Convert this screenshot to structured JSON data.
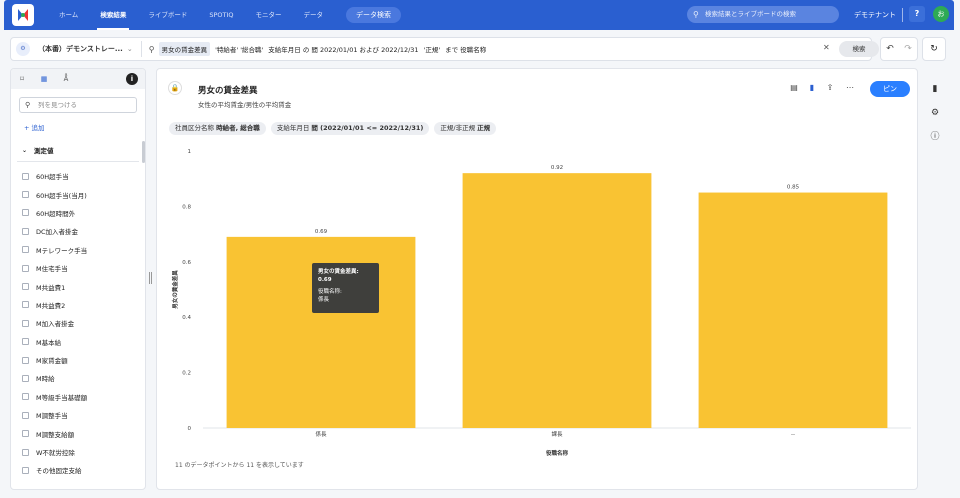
{
  "topnav": {
    "links": [
      "ホーム",
      "検索結果",
      "ライブボード",
      "SPOTIQ",
      "モニター",
      "データ"
    ],
    "active_index": 1,
    "data_search_label": "データ検索",
    "search_placeholder": "検索結果とライブボードの検索",
    "tenant": "デモテナント",
    "help": "?",
    "avatar": "お"
  },
  "searchbar": {
    "source_name": "（本番）デモンストレー...",
    "tokens": [
      {
        "text": "男女の賃金差異",
        "highlight": true
      },
      {
        "text": "'特給者' '総合職'",
        "highlight": false
      },
      {
        "text": "支給年月日 の 間 2022/01/01 および 2022/12/31",
        "highlight": false
      },
      {
        "text": "'正規'",
        "highlight": false
      },
      {
        "text": "まで 役職名称",
        "highlight": false
      }
    ],
    "search_button": "検索"
  },
  "left_panel": {
    "search_placeholder": "列を見つける",
    "add_label": "追加",
    "group_label": "測定値",
    "items": [
      "60H超手当",
      "60H超手当(当月)",
      "60H超時間外",
      "DC加入者掛金",
      "Mテレワーク手当",
      "M住宅手当",
      "M共益費1",
      "M共益費2",
      "M加入者掛金",
      "M基本給",
      "M家賃金額",
      "M時給",
      "M等級手当基礎額",
      "M調整手当",
      "M調整支給額",
      "W不就労控除",
      "その他固定支給"
    ]
  },
  "chart_panel": {
    "title": "男女の賃金差異",
    "subtitle": "女性の平均賃金/男性の平均賃金",
    "pin_label": "ピン",
    "filters": [
      {
        "name": "社員区分名称",
        "value": "時給者, 総合職"
      },
      {
        "name": "支給年月日",
        "value": "間 (2022/01/01 <= 2022/12/31)"
      },
      {
        "name": "正規/非正規",
        "value": "正規"
      }
    ],
    "tooltip": {
      "measure_label": "男女の賃金差異:",
      "measure_value": "0.69",
      "dim_label": "役職名称:",
      "dim_value": "係長"
    },
    "footnote": "11 のデータポイントから 11 を表示しています"
  },
  "chart_data": {
    "type": "bar",
    "categories": [
      "係長",
      "課長",
      "--"
    ],
    "values": [
      0.69,
      0.92,
      0.85
    ],
    "value_labels": [
      "0.69",
      "0.92",
      "0.85"
    ],
    "ylabel": "男女の賃金差異",
    "xlabel": "役職名称",
    "ylim": [
      0,
      1
    ],
    "yticks": [
      0,
      0.2,
      0.4,
      0.6,
      0.8,
      1
    ],
    "ytick_labels": [
      "0",
      "0.2",
      "0.4",
      "0.6",
      "0.8",
      "1"
    ],
    "bar_color": "#f9c333",
    "grid": false
  },
  "colors": {
    "nav": "#2a5fd0",
    "accent": "#2a7fff",
    "bar": "#f9c333"
  }
}
